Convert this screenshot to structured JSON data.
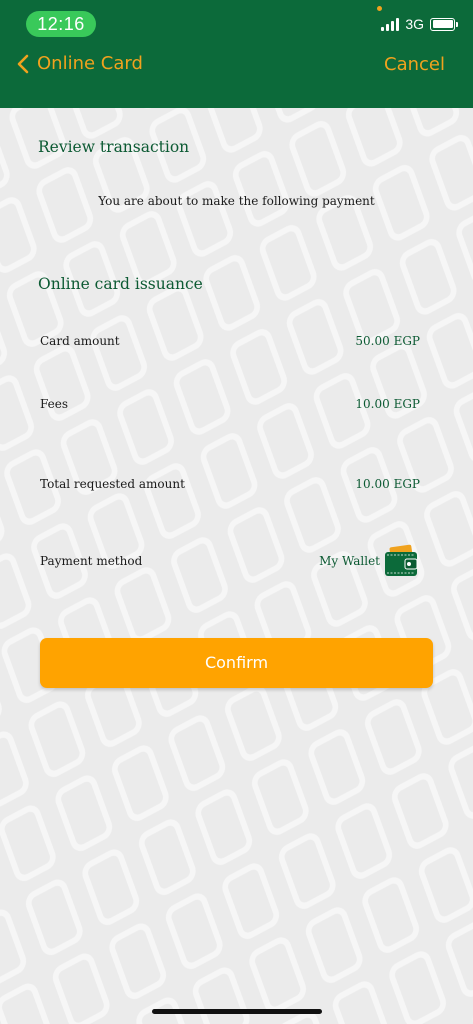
{
  "status_bar": {
    "time": "12:16",
    "network": "3G"
  },
  "nav": {
    "back_label": "Online Card",
    "cancel_label": "Cancel"
  },
  "review": {
    "title": "Review transaction",
    "subtitle": "You are about to make the following payment"
  },
  "issuance": {
    "title": "Online card issuance",
    "rows": [
      {
        "label": "Card amount",
        "value": "50.00 EGP"
      },
      {
        "label": "Fees",
        "value": "10.00 EGP"
      },
      {
        "label": "Total requested amount",
        "value": "10.00 EGP"
      }
    ],
    "payment_method_label": "Payment method",
    "payment_method_value": "My Wallet",
    "payment_method_icon": "wallet-icon"
  },
  "actions": {
    "confirm_label": "Confirm"
  },
  "colors": {
    "header_green": "#0c6a3a",
    "text_green": "#0c5a33",
    "accent_orange": "#ffa300",
    "time_pill_green": "#39c95a",
    "background": "#ebebeb"
  }
}
